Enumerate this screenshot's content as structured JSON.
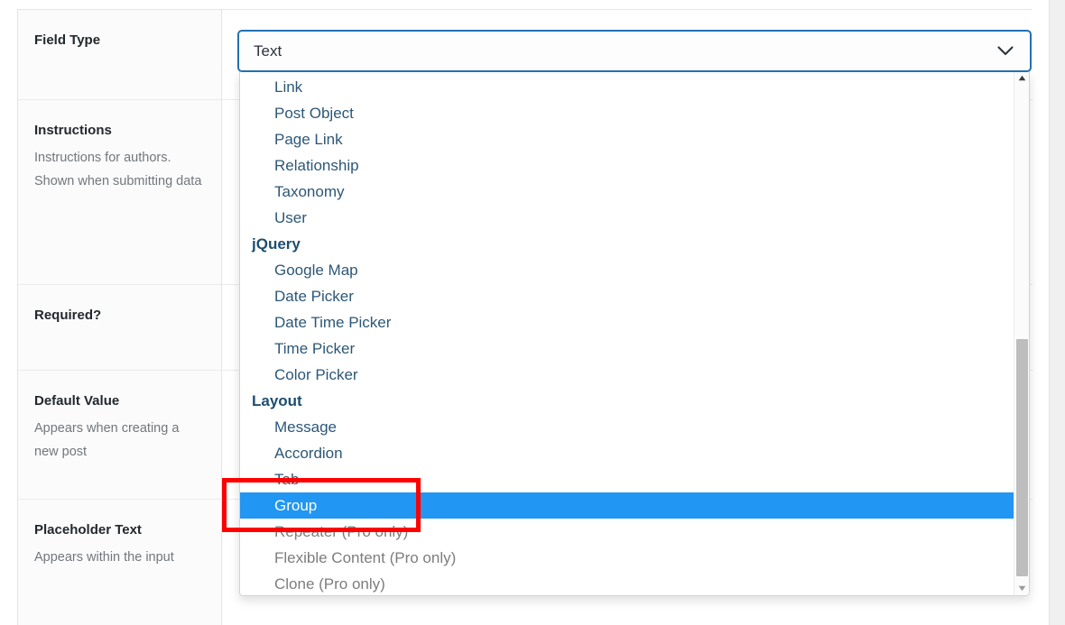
{
  "panel": {
    "rows": [
      {
        "id": "field-type",
        "label": "Field Type",
        "description": ""
      },
      {
        "id": "instructions",
        "label": "Instructions",
        "description": "Instructions for authors. Shown when submitting data"
      },
      {
        "id": "required",
        "label": "Required?",
        "description": ""
      },
      {
        "id": "default-value",
        "label": "Default Value",
        "description": "Appears when creating a new post"
      },
      {
        "id": "placeholder-text",
        "label": "Placeholder Text",
        "description": "Appears within the input"
      }
    ]
  },
  "field_type_select": {
    "value": "Text",
    "chevron_icon": "chevron-down-icon",
    "border_color": "#2271b1",
    "expanded": true,
    "options": [
      {
        "label": "Link",
        "type": "option",
        "state": "normal"
      },
      {
        "label": "Post Object",
        "type": "option",
        "state": "normal"
      },
      {
        "label": "Page Link",
        "type": "option",
        "state": "normal"
      },
      {
        "label": "Relationship",
        "type": "option",
        "state": "normal"
      },
      {
        "label": "Taxonomy",
        "type": "option",
        "state": "normal"
      },
      {
        "label": "User",
        "type": "option",
        "state": "normal"
      },
      {
        "label": "jQuery",
        "type": "group",
        "state": "normal"
      },
      {
        "label": "Google Map",
        "type": "option",
        "state": "normal"
      },
      {
        "label": "Date Picker",
        "type": "option",
        "state": "normal"
      },
      {
        "label": "Date Time Picker",
        "type": "option",
        "state": "normal"
      },
      {
        "label": "Time Picker",
        "type": "option",
        "state": "normal"
      },
      {
        "label": "Color Picker",
        "type": "option",
        "state": "normal"
      },
      {
        "label": "Layout",
        "type": "group",
        "state": "normal"
      },
      {
        "label": "Message",
        "type": "option",
        "state": "normal"
      },
      {
        "label": "Accordion",
        "type": "option",
        "state": "normal"
      },
      {
        "label": "Tab",
        "type": "option",
        "state": "normal"
      },
      {
        "label": "Group",
        "type": "option",
        "state": "selected"
      },
      {
        "label": "Repeater (Pro only)",
        "type": "option",
        "state": "disabled"
      },
      {
        "label": "Flexible Content (Pro only)",
        "type": "option",
        "state": "disabled"
      },
      {
        "label": "Clone (Pro only)",
        "type": "option",
        "state": "disabled"
      }
    ],
    "highlight_color": "#2196f3",
    "scrollbar": {
      "up_arrow_icon": "scroll-up-arrow-icon",
      "down_arrow_icon": "scroll-down-arrow-icon",
      "thumb_color": "#bdbdbd"
    }
  },
  "annotation": {
    "color": "#ff0000",
    "target_label": "Group"
  }
}
